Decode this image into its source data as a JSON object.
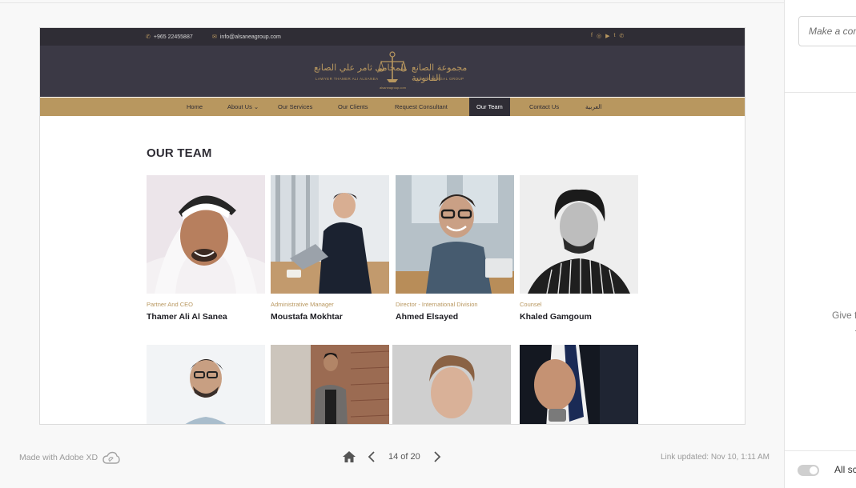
{
  "topbar": {
    "phone": "+965 22455887",
    "email": "info@alsaneagroup.com",
    "socials": [
      "f",
      "◎",
      "▶",
      "t",
      "✆"
    ]
  },
  "logo": {
    "arabic_left": "المحامي ثامر علي الصانع",
    "arabic_right": "مجموعة الصانع القانونية",
    "english_left": "LAWYER THAMER ALI ALSANEA",
    "english_right": "ALSANEA LEGAL GROUP",
    "tagline": "alsaneagroup.com"
  },
  "nav": {
    "items": [
      "Home",
      "About Us ⌄",
      "Our Services",
      "Our Clients",
      "Request Consultant",
      "Our Team",
      "Contact Us",
      "العربية"
    ],
    "active": "Our Team"
  },
  "section_title": "OUR TEAM",
  "team": [
    {
      "role": "Partner And CEO",
      "name": "Thamer Ali Al Sanea"
    },
    {
      "role": "Administrative Manager",
      "name": "Moustafa Mokhtar"
    },
    {
      "role": "Director - International  Division",
      "name": "Ahmed Elsayed"
    },
    {
      "role": "Counsel",
      "name": "Khaled Gamgoum"
    }
  ],
  "footer": {
    "made_with": "Made with Adobe XD",
    "page_count": "14 of 20",
    "link_updated": "Link updated: Nov 10, 1:11 AM"
  },
  "right_panel": {
    "comment_placeholder": "Make a cor",
    "give_text": "Give f",
    "give_dot": "·",
    "all_label": "All sc"
  },
  "colors": {
    "gold": "#b8975f",
    "dark": "#2f2d35",
    "header": "#3b3945"
  }
}
